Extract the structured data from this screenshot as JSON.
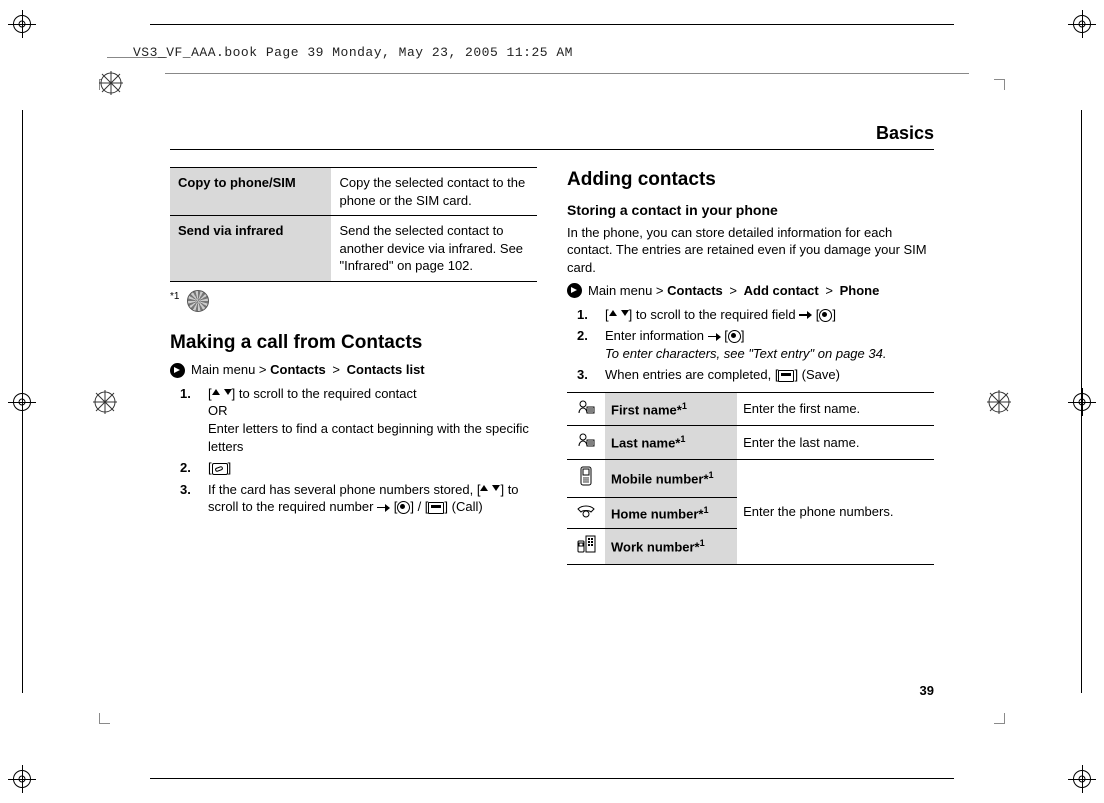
{
  "doc_header": "VS3_VF_AAA.book  Page 39  Monday, May 23, 2005  11:25 AM",
  "section_title": "Basics",
  "page_number": "39",
  "footnote_marker": "*1",
  "left": {
    "table": [
      {
        "label": "Copy to phone/SIM",
        "desc": "Copy the selected contact to the phone or the SIM card."
      },
      {
        "label": "Send via infrared",
        "desc": "Send the selected contact to another device via infrared. See \"Infrared\" on page 102."
      }
    ],
    "h2": "Making a call from Contacts",
    "crumb_prefix": "Main menu >",
    "crumb_a": "Contacts",
    "crumb_sep": ">",
    "crumb_b": "Contacts list",
    "steps": {
      "s1a": "to scroll to the required contact",
      "s1b": "OR",
      "s1c": "Enter letters to find a contact beginning with the specific letters",
      "s3a": "If the card has several phone numbers stored,",
      "s3b": "to scroll to the required number",
      "s3c": "(Call)"
    }
  },
  "right": {
    "h2": "Adding contacts",
    "h3": "Storing a contact in your phone",
    "intro": "In the phone, you can store detailed information for each contact. The entries are retained even if you damage your SIM card.",
    "crumb_prefix": "Main menu >",
    "crumb_a": "Contacts",
    "crumb_sep": ">",
    "crumb_b": "Add contact",
    "crumb_c": "Phone",
    "steps": {
      "s1": "to scroll to the required field",
      "s2a": "Enter information",
      "s2b": "To enter characters, see \"Text entry\" on page 34.",
      "s3a": "When entries are completed,",
      "s3b": "(Save)"
    },
    "table": {
      "first": {
        "label": "First name*",
        "sup": "1",
        "desc": "Enter the first name."
      },
      "last": {
        "label": "Last name*",
        "sup": "1",
        "desc": "Enter the last name."
      },
      "mobile": {
        "label": "Mobile number*",
        "sup": "1"
      },
      "home": {
        "label": "Home number*",
        "sup": "1"
      },
      "work": {
        "label": "Work number*",
        "sup": "1"
      },
      "numbers_desc": "Enter the phone numbers."
    }
  }
}
